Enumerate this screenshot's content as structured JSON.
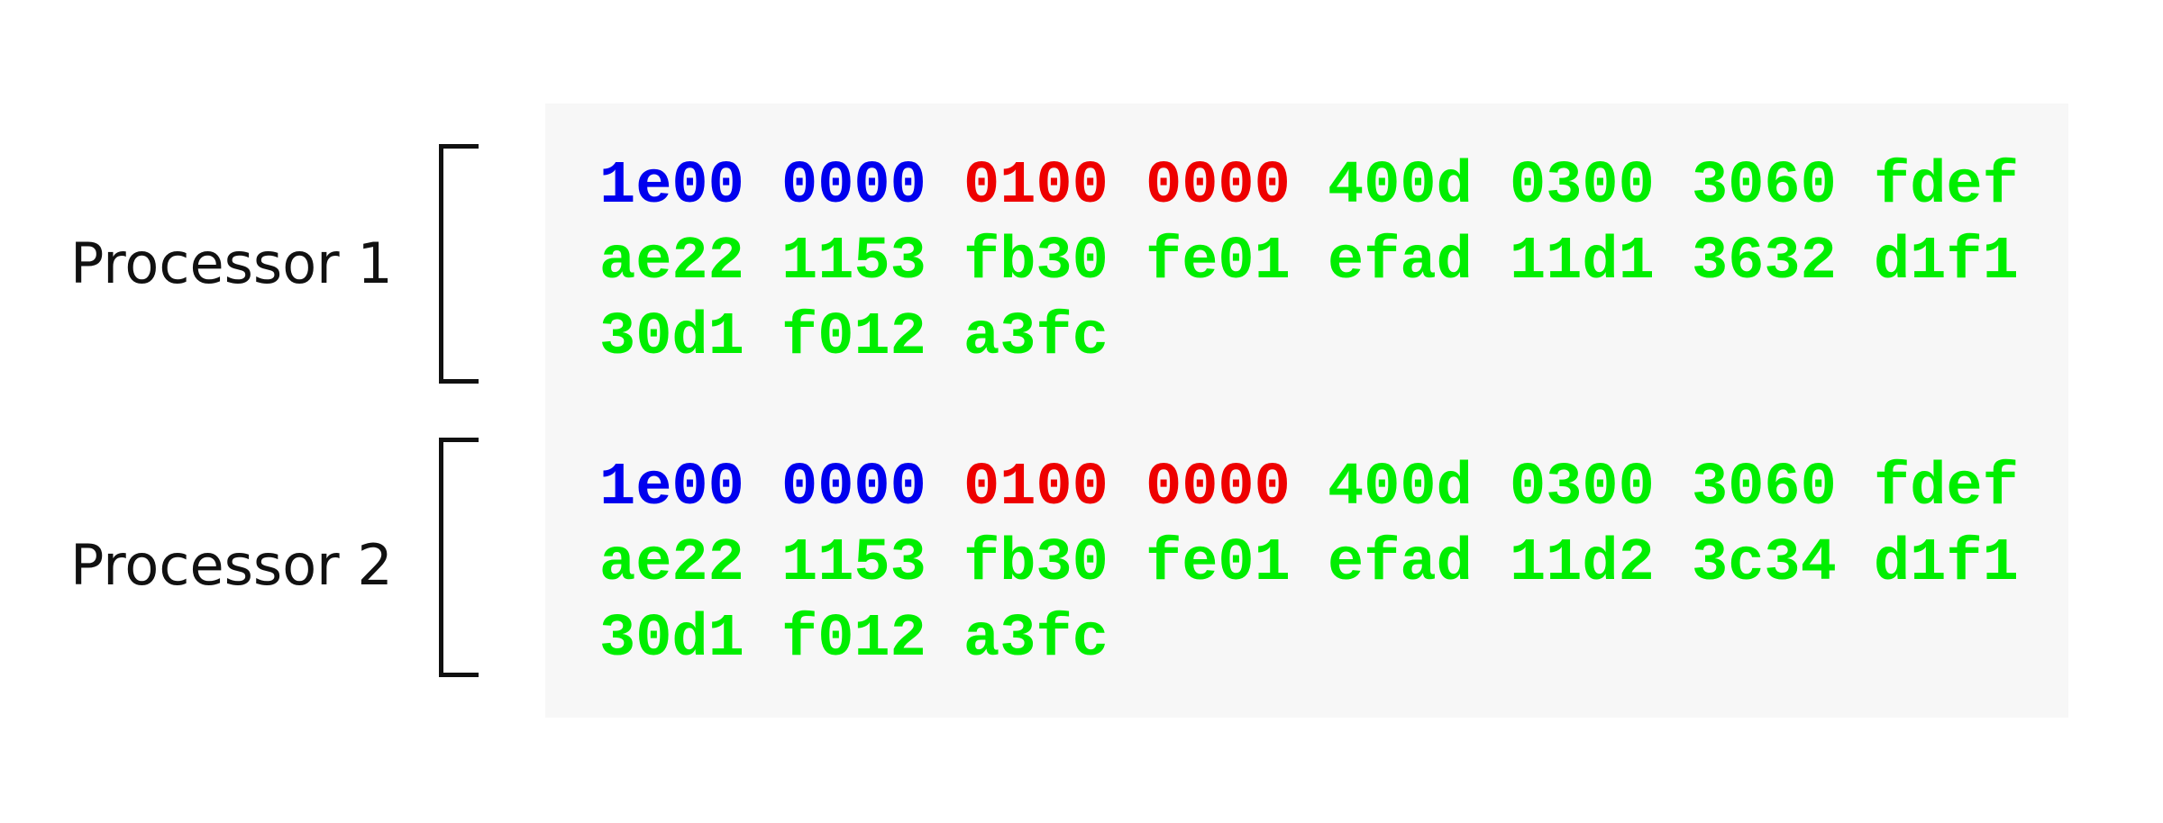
{
  "colors": {
    "blue": "#0000ee",
    "red": "#ee0000",
    "green": "#00ee00",
    "panel_background": "#f7f7f7",
    "label_text": "#111111"
  },
  "processors": [
    {
      "label": "Processor 1",
      "lines": [
        [
          {
            "text": "1e00",
            "color": "blue"
          },
          {
            "text": "0000",
            "color": "blue"
          },
          {
            "text": "0100",
            "color": "red"
          },
          {
            "text": "0000",
            "color": "red"
          },
          {
            "text": "400d",
            "color": "green"
          },
          {
            "text": "0300",
            "color": "green"
          },
          {
            "text": "3060",
            "color": "green"
          },
          {
            "text": "fdef",
            "color": "green"
          }
        ],
        [
          {
            "text": "ae22",
            "color": "green"
          },
          {
            "text": "1153",
            "color": "green"
          },
          {
            "text": "fb30",
            "color": "green"
          },
          {
            "text": "fe01",
            "color": "green"
          },
          {
            "text": "efad",
            "color": "green"
          },
          {
            "text": "11d1",
            "color": "green"
          },
          {
            "text": "3632",
            "color": "green"
          },
          {
            "text": "d1f1",
            "color": "green"
          }
        ],
        [
          {
            "text": "30d1",
            "color": "green"
          },
          {
            "text": "f012",
            "color": "green"
          },
          {
            "text": "a3fc",
            "color": "green"
          }
        ]
      ]
    },
    {
      "label": "Processor 2",
      "lines": [
        [
          {
            "text": "1e00",
            "color": "blue"
          },
          {
            "text": "0000",
            "color": "blue"
          },
          {
            "text": "0100",
            "color": "red"
          },
          {
            "text": "0000",
            "color": "red"
          },
          {
            "text": "400d",
            "color": "green"
          },
          {
            "text": "0300",
            "color": "green"
          },
          {
            "text": "3060",
            "color": "green"
          },
          {
            "text": "fdef",
            "color": "green"
          }
        ],
        [
          {
            "text": "ae22",
            "color": "green"
          },
          {
            "text": "1153",
            "color": "green"
          },
          {
            "text": "fb30",
            "color": "green"
          },
          {
            "text": "fe01",
            "color": "green"
          },
          {
            "text": "efad",
            "color": "green"
          },
          {
            "text": "11d2",
            "color": "green"
          },
          {
            "text": "3c34",
            "color": "green"
          },
          {
            "text": "d1f1",
            "color": "green"
          }
        ],
        [
          {
            "text": "30d1",
            "color": "green"
          },
          {
            "text": "f012",
            "color": "green"
          },
          {
            "text": "a3fc",
            "color": "green"
          }
        ]
      ]
    }
  ]
}
